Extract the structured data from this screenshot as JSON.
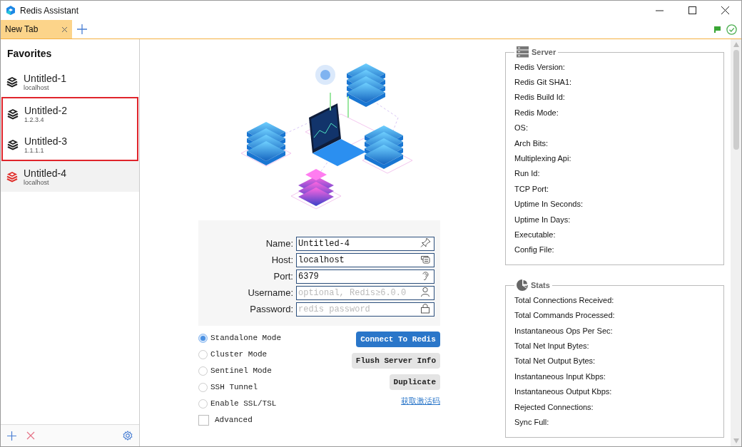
{
  "window": {
    "title": "Redis Assistant"
  },
  "tabs": [
    {
      "label": "New Tab",
      "selected": true
    }
  ],
  "sidebar": {
    "title": "Favorites",
    "items": [
      {
        "name": "Untitled-1",
        "host": "localhost",
        "selected": false,
        "outlined": false
      },
      {
        "name": "Untitled-2",
        "host": "1.2.3.4",
        "selected": false,
        "outlined": true
      },
      {
        "name": "Untitled-3",
        "host": "1.1.1.1",
        "selected": false,
        "outlined": true
      },
      {
        "name": "Untitled-4",
        "host": "localhost",
        "selected": true,
        "outlined": false
      }
    ]
  },
  "form": {
    "fields": [
      {
        "label": "Name:",
        "value": "Untitled-4"
      },
      {
        "label": "Host:",
        "value": "localhost"
      },
      {
        "label": "Port:",
        "value": "6379"
      },
      {
        "label": "Username:",
        "placeholder": "optional, Redis≥6.0.0"
      },
      {
        "label": "Password:",
        "placeholder": "redis password"
      }
    ],
    "modes": [
      {
        "label": "Standalone Mode",
        "selected": true
      },
      {
        "label": "Cluster Mode",
        "selected": false
      },
      {
        "label": "Sentinel Mode",
        "selected": false
      },
      {
        "label": "SSH Tunnel",
        "selected": false
      },
      {
        "label": "Enable SSL/TSL",
        "selected": false
      }
    ],
    "advanced": {
      "label": "Advanced",
      "checked": false
    },
    "buttons": [
      {
        "label": "Connect To Redis",
        "kind": "primary"
      },
      {
        "label": "Flush Server Info",
        "kind": "secondary"
      },
      {
        "label": "Duplicate",
        "kind": "secondary"
      }
    ],
    "link": "获取激活码"
  },
  "server": {
    "title": "Server",
    "rows": [
      "Redis Version:",
      "Redis Git SHA1:",
      "Redis Build Id:",
      "Redis Mode:",
      "OS:",
      "Arch Bits:",
      "Multiplexing Api:",
      "Run Id:",
      "TCP Port:",
      "Uptime In Seconds:",
      "Uptime In Days:",
      "Executable:",
      "Config File:"
    ]
  },
  "stats": {
    "title": "Stats",
    "rows": [
      "Total Connections Received:",
      "Total Commands Processed:",
      "Instantaneous Ops Per Sec:",
      "Total Net Input Bytes:",
      "Total Net Output Bytes:",
      "Instantaneous Input Kbps:",
      "Instantaneous Output Kbps:",
      "Rejected Connections:",
      "Sync Full:"
    ]
  }
}
